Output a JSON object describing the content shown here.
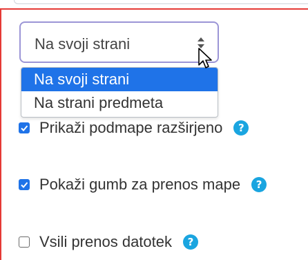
{
  "select": {
    "value": "Na svoji strani",
    "options": [
      "Na svoji strani",
      "Na strani predmeta"
    ],
    "selected_index": 0
  },
  "checkboxes": [
    {
      "label": "Prikaži podmape razširjeno",
      "checked": true,
      "help": "?"
    },
    {
      "label": "Pokaži gumb za prenos mape",
      "checked": true,
      "help": "?"
    },
    {
      "label": "Vsili prenos datotek",
      "checked": false,
      "help": "?"
    }
  ],
  "colors": {
    "accent": "#1f73e8",
    "help": "#1aa5e0",
    "highlight_border": "#e53935",
    "focus_border": "#9b95d6"
  }
}
